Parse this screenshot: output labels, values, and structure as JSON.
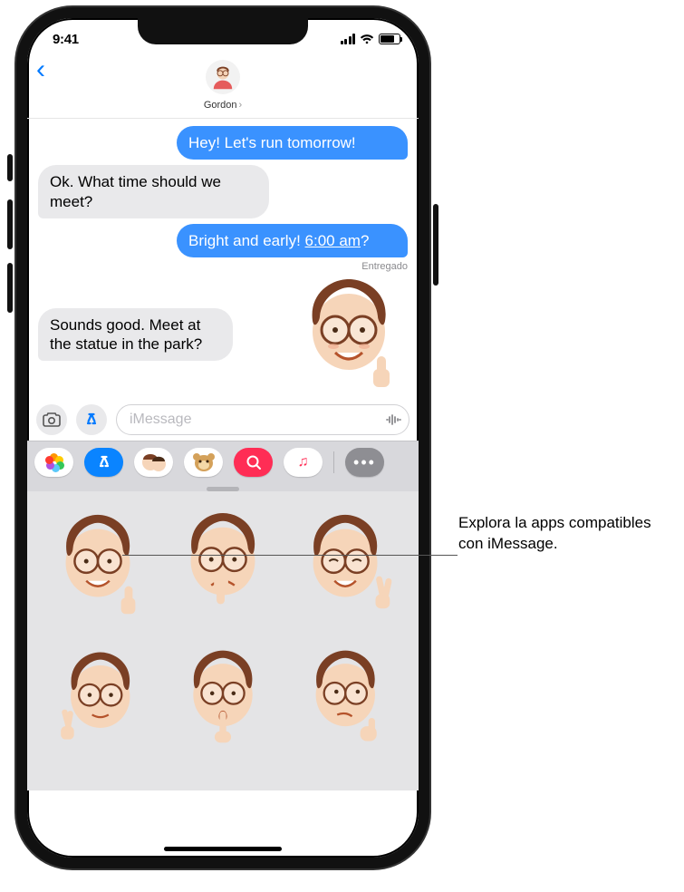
{
  "statusbar": {
    "time": "9:41"
  },
  "contact": {
    "name": "Gordon"
  },
  "messages": {
    "m1": "Hey! Let's run tomorrow!",
    "m2": "Ok. What time should we meet?",
    "m3_a": "Bright and early! ",
    "m3_b": "6:00 am",
    "m3_c": "?",
    "delivered": "Entregado",
    "m4": "Sounds good. Meet at the statue in the park?"
  },
  "input": {
    "placeholder": "iMessage"
  },
  "app_strip": {
    "items": [
      {
        "name": "photos"
      },
      {
        "name": "app-store"
      },
      {
        "name": "memoji"
      },
      {
        "name": "animoji"
      },
      {
        "name": "search"
      },
      {
        "name": "music"
      },
      {
        "name": "more"
      }
    ]
  },
  "sticker_panel": {
    "stickers": [
      "thumbs-up",
      "thumbs-down",
      "peace",
      "fingers-crossed",
      "shush",
      "thinking"
    ]
  },
  "callout": {
    "text": "Explora la apps compatibles con iMessage."
  }
}
